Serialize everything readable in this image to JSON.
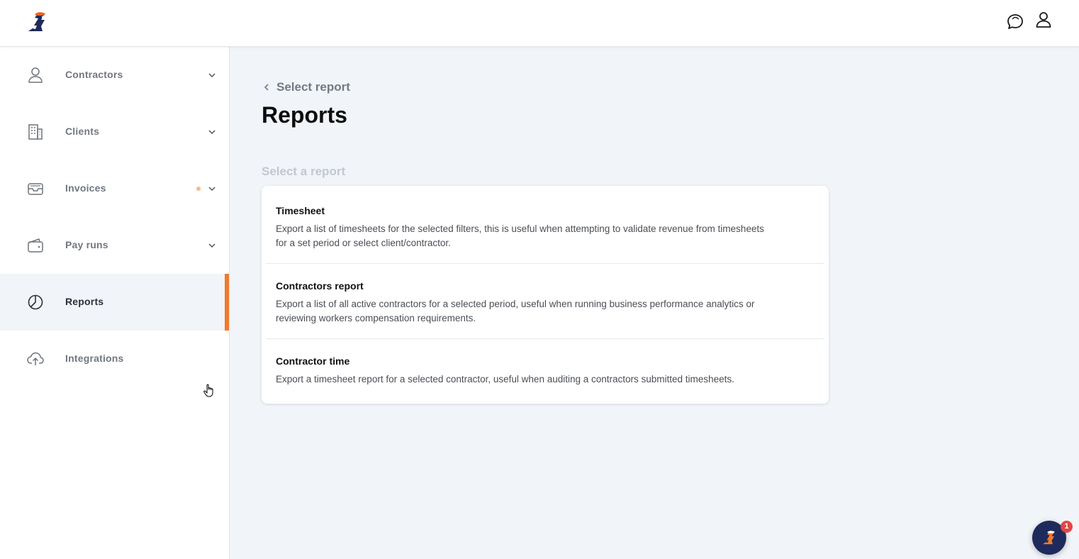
{
  "header": {
    "logo": "zeeko-logo-icon",
    "icons": [
      "chat-icon",
      "user-icon"
    ]
  },
  "sidebar": {
    "items": [
      {
        "label": "Contractors",
        "icon": "user-icon",
        "has_chevron": true
      },
      {
        "label": "Clients",
        "icon": "building-icon",
        "has_chevron": true
      },
      {
        "label": "Invoices",
        "icon": "inbox-icon",
        "has_chevron": true,
        "notification": true
      },
      {
        "label": "Pay runs",
        "icon": "wallet-icon",
        "has_chevron": true
      },
      {
        "label": "Reports",
        "icon": "pie-chart-icon",
        "active": true
      },
      {
        "label": "Integrations",
        "icon": "cloud-upload-icon"
      }
    ]
  },
  "main": {
    "back_label": "Select report",
    "title": "Reports",
    "section_label": "Select a report",
    "reports": [
      {
        "title": "Timesheet",
        "description": "Export a list of timesheets for the selected filters, this is useful when attempting to validate revenue from timesheets for a set period or select client/contractor."
      },
      {
        "title": "Contractors report",
        "description": "Export a list of all active contractors for a selected period, useful when running business performance analytics or reviewing workers compensation requirements."
      },
      {
        "title": "Contractor time",
        "description": "Export a timesheet report for a selected contractor, useful when auditing a contractors submitted timesheets."
      }
    ]
  },
  "chat_launcher": {
    "badge": "1"
  },
  "colors": {
    "accent": "#f07a2a",
    "background": "#f1f4f8",
    "launcher": "#1f2a5c",
    "badge": "#e34646"
  }
}
